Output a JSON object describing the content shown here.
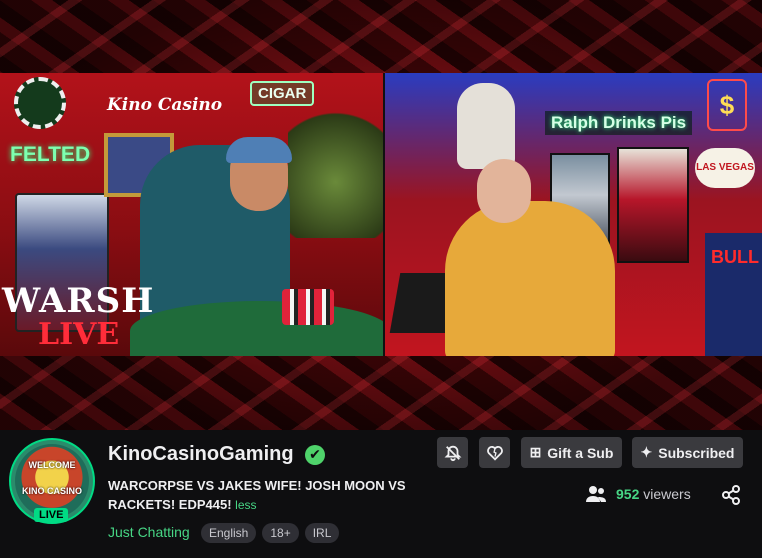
{
  "stream": {
    "left_scene": {
      "felted_sign": "FELTED",
      "kino_sign": "Kino Casino",
      "cigar_sign": "CIGAR",
      "warsh_text": "WARSH",
      "live_text": "LIVE"
    },
    "right_scene": {
      "ralph_sign": "Ralph Drinks Pis",
      "vegas_sign": "LAS VEGAS",
      "dollar_sign": "$",
      "redbull_text": "BULL"
    }
  },
  "channel": {
    "avatar_text_top": "WELCOME",
    "avatar_text_bottom": "KINO CASINO",
    "live_badge": "LIVE",
    "name": "KinoCasinoGaming",
    "verified_icon": "✔",
    "title": "WARCORPSE VS JAKES WIFE! JOSH MOON VS RACKETS! EDP445!",
    "less_link": "less",
    "category": "Just Chatting",
    "tags": [
      "English",
      "18+",
      "IRL"
    ]
  },
  "actions": {
    "notifications_icon": "bell-off-icon",
    "heart_icon": "heart-broken-icon",
    "gift_label": "Gift a Sub",
    "subscribed_label": "Subscribed"
  },
  "viewers": {
    "count": "952",
    "label": "viewers"
  },
  "colors": {
    "accent": "#00db84",
    "link": "#47d685",
    "button_bg": "#3a3a3e"
  }
}
